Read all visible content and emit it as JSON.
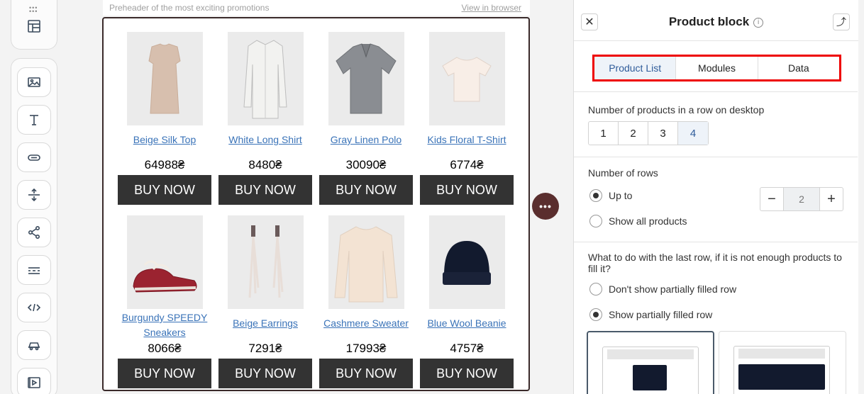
{
  "email": {
    "preheader": "Preheader of the most exciting promotions",
    "view_in_browser": "View in browser",
    "buy_label": "BUY NOW",
    "products": [
      {
        "name": "Beige Silk Top",
        "price": "64988₴",
        "icon": "top-icon"
      },
      {
        "name": "White Long Shirt",
        "price": "8480₴",
        "icon": "shirt-icon"
      },
      {
        "name": "Gray Linen Polo",
        "price": "30090₴",
        "icon": "polo-icon"
      },
      {
        "name": "Kids Floral T-Shirt",
        "price": "6774₴",
        "icon": "tshirt-icon"
      },
      {
        "name": "Burgundy SPEEDY Sneakers",
        "price": "8066₴",
        "icon": "sneaker-icon"
      },
      {
        "name": "Beige Earrings",
        "price": "7291₴",
        "icon": "earrings-icon"
      },
      {
        "name": "Cashmere Sweater",
        "price": "17993₴",
        "icon": "sweater-icon"
      },
      {
        "name": "Blue Wool Beanie",
        "price": "4757₴",
        "icon": "beanie-icon"
      }
    ]
  },
  "panel": {
    "title": "Product block",
    "tabs": [
      "Product List",
      "Modules",
      "Data"
    ],
    "active_tab": "Product List",
    "per_row_label": "Number of products in a row on desktop",
    "per_row_options": [
      "1",
      "2",
      "3",
      "4"
    ],
    "per_row_selected": "4",
    "rows_label": "Number of rows",
    "up_to_label": "Up to",
    "rows_value": "2",
    "show_all_label": "Show all products",
    "last_row_label": "What to do with the last row, if it is not enough products to fill it?",
    "dont_show_label": "Don't show partially filled row",
    "show_partial_label": "Show partially filled row"
  },
  "colors": {
    "accent": "#2f5c9a",
    "buy_bg": "#333333",
    "link": "#3a73b8",
    "highlight": "#ee0000"
  }
}
